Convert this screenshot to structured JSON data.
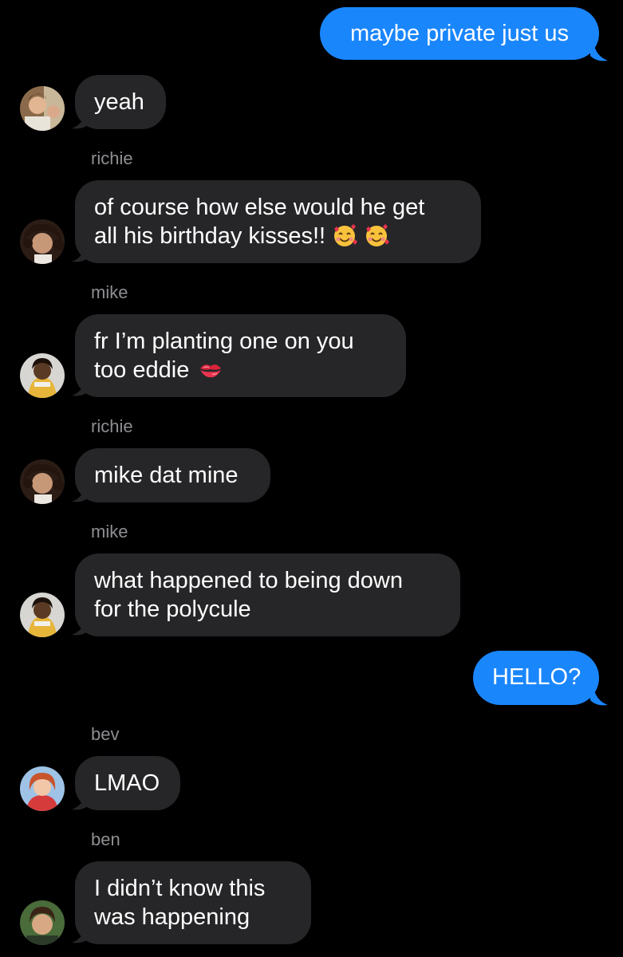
{
  "colors": {
    "background": "#000000",
    "received_bubble": "#262628",
    "sent_bubble": "#1a86fc",
    "sender_name": "#8e8e93",
    "text": "#ffffff"
  },
  "messages": [
    {
      "type": "sent",
      "text": "maybe private just us"
    },
    {
      "type": "received",
      "sender": "",
      "lines": [
        "yeah"
      ],
      "avatar": "avatar-photo-1"
    },
    {
      "type": "received",
      "sender": "richie",
      "lines": [
        "of course how else would he get",
        "all his birthday kisses!!"
      ],
      "emojis": [
        "smiling-face-with-hearts-emoji",
        "smiling-face-with-hearts-emoji"
      ],
      "avatar": "avatar-richie"
    },
    {
      "type": "received",
      "sender": "mike",
      "lines": [
        "fr I’m planting one on you",
        "too eddie"
      ],
      "emojis": [
        "kiss-mark-emoji"
      ],
      "avatar": "avatar-mike"
    },
    {
      "type": "received",
      "sender": "richie",
      "lines": [
        "mike dat mine"
      ],
      "avatar": "avatar-richie"
    },
    {
      "type": "received",
      "sender": "mike",
      "lines": [
        "what happened to being down",
        "for the polycule"
      ],
      "avatar": "avatar-mike"
    },
    {
      "type": "sent",
      "text": "HELLO?"
    },
    {
      "type": "received",
      "sender": "bev",
      "lines": [
        "LMAO"
      ],
      "avatar": "avatar-bev"
    },
    {
      "type": "received",
      "sender": "ben",
      "lines": [
        "I didn’t know this",
        "was happening"
      ],
      "avatar": "avatar-ben"
    }
  ]
}
